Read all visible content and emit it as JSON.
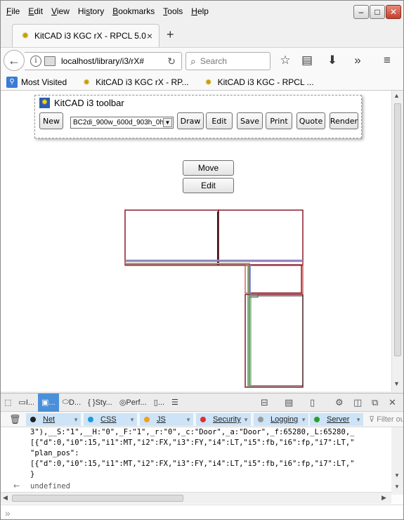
{
  "window": {
    "menu": [
      {
        "pre": "",
        "ul": "F",
        "post": "ile"
      },
      {
        "pre": "",
        "ul": "E",
        "post": "dit"
      },
      {
        "pre": "",
        "ul": "V",
        "post": "iew"
      },
      {
        "pre": "Hi",
        "ul": "s",
        "post": "tory"
      },
      {
        "pre": "",
        "ul": "B",
        "post": "ookmarks"
      },
      {
        "pre": "",
        "ul": "T",
        "post": "ools"
      },
      {
        "pre": "",
        "ul": "H",
        "post": "elp"
      }
    ],
    "controls": {
      "minimize": "–",
      "maximize": "□",
      "close": "✕"
    }
  },
  "tab": {
    "title": "KitCAD i3 KGC rX - RPCL 5.0",
    "close": "×",
    "new_tab": "+"
  },
  "nav": {
    "url": "localhost/library/i3/rX#",
    "search_placeholder": "Search",
    "icons": [
      "back-icon",
      "info-icon",
      "reload-icon",
      "search-icon",
      "star-icon",
      "reading-list-icon",
      "download-icon",
      "overflow-icon",
      "hamburger-icon"
    ]
  },
  "bookmarks": [
    {
      "label": "Most Visited"
    },
    {
      "label": "KitCAD i3 KGC rX - RP..."
    },
    {
      "label": "KitCAD i3 KGC - RPCL ..."
    }
  ],
  "kitcad": {
    "toolbar_title": "KitCAD i3 toolbar",
    "new_label": "New",
    "select_value": "BC2di_900w_600d_903h_0hf",
    "buttons": [
      "Draw",
      "Edit",
      "Save",
      "Print",
      "Quote",
      "Render"
    ],
    "move_label": "Move",
    "edit_label": "Edit"
  },
  "devtools": {
    "tabs": [
      "I...",
      "...",
      "D...",
      "Sty...",
      "Perf...",
      "..."
    ],
    "active_tab_index": 1,
    "filters": [
      {
        "label": "Net",
        "color": "#222222"
      },
      {
        "label": "CSS",
        "color": "#1e9bd7"
      },
      {
        "label": "JS",
        "color": "#f0a020"
      },
      {
        "label": "Security",
        "color": "#e03030"
      },
      {
        "label": "Logging",
        "color": "#999999"
      },
      {
        "label": "Server",
        "color": "#2aa02a"
      }
    ],
    "filter_output_placeholder": "Filter output",
    "console_lines": [
      "3\"),__S:\"1\",__H:\"0\",_F:\"1\",_r:\"0\",_c:\"Door\",_a:\"Door\",_f:65280,_L:65280,_",
      "[{\"d\":0,\"i0\":15,\"i1\":MT,\"i2\":FX,\"i3\":FY,\"i4\":LT,\"i5\":fb,\"i6\":fp,\"i7\":LT,\"",
      "\"plan_pos\":",
      "[{\"d\":0,\"i0\":15,\"i1\":MT,\"i2\":FX,\"i3\":FY,\"i4\":LT,\"i5\":fb,\"i6\":fp,\"i7\":LT,\"",
      "}"
    ],
    "result": "undefined",
    "prompt": "»"
  }
}
